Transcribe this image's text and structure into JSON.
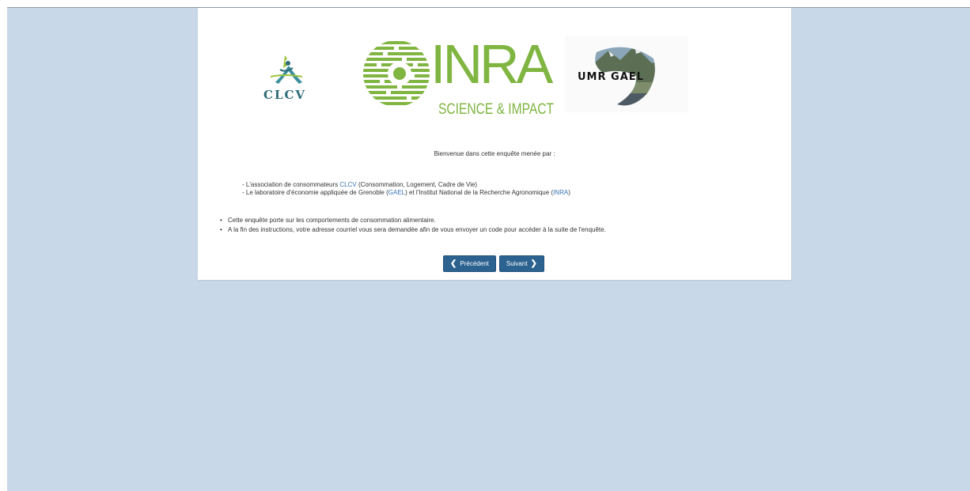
{
  "logos": {
    "clcv": {
      "text": "CLCV"
    },
    "inra": {
      "name": "INRA",
      "tagline": "SCIENCE & IMPACT"
    },
    "gael": {
      "text": "UMR GAEL"
    }
  },
  "welcome": "Bienvenue dans cette enquête menée par :",
  "credits": {
    "line1_pre": "- L'association de consommateurs ",
    "line1_link": "CLCV",
    "line1_post": " (Consommation, Logement, Cadre de Vie)",
    "line2_pre": "- Le laboratoire d'économie appliquée de Grenoble (",
    "line2_link1": "GAEL",
    "line2_mid": ") et l'Institut National de la Recherche Agronomique (",
    "line2_link2": "INRA",
    "line2_post": ")"
  },
  "bullets": [
    "Cette enquête porte sur les comportements de consommation alimentaire.",
    "A la fin des instructions, votre adresse courriel vous sera demandée afin de vous envoyer un code pour accéder à la suite de l'enquête."
  ],
  "buttons": {
    "previous": "Précédent",
    "next": "Suivant"
  },
  "icons": {
    "previous": "chevron-left-icon",
    "next": "chevron-right-icon"
  },
  "colors": {
    "background": "#c9d8e8",
    "button": "#2c628f",
    "link": "#3a73b5",
    "inra_green": "#7fb540"
  }
}
